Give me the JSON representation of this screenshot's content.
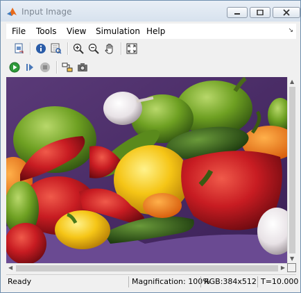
{
  "window": {
    "title": "Input Image"
  },
  "menubar": {
    "items": [
      "File",
      "Tools",
      "View",
      "Simulation",
      "Help"
    ],
    "overflow_arrow": "↘"
  },
  "toolbar_top": {
    "buttons": [
      {
        "icon": "print-to-figure-icon",
        "label": ""
      },
      {
        "icon": "info-icon",
        "label": ""
      },
      {
        "icon": "inspect-pixel-icon",
        "label": ""
      },
      {
        "icon": "zoom-in-icon",
        "label": ""
      },
      {
        "icon": "zoom-out-icon",
        "label": ""
      },
      {
        "icon": "pan-hand-icon",
        "label": ""
      },
      {
        "icon": "fit-to-window-icon",
        "label": ""
      }
    ]
  },
  "toolbar_sim": {
    "buttons": [
      {
        "icon": "run-icon"
      },
      {
        "icon": "step-forward-icon"
      },
      {
        "icon": "stop-icon"
      },
      {
        "icon": "highlight-in-model-icon"
      },
      {
        "icon": "snapshot-camera-icon"
      }
    ]
  },
  "statusbar": {
    "status": "Ready",
    "magnification": "Magnification: 100%",
    "image_info": "RGB:384x512",
    "time": "T=10.000"
  },
  "colors": {
    "title_bar": "#dde6f0",
    "accent": "#1f6fc5"
  }
}
